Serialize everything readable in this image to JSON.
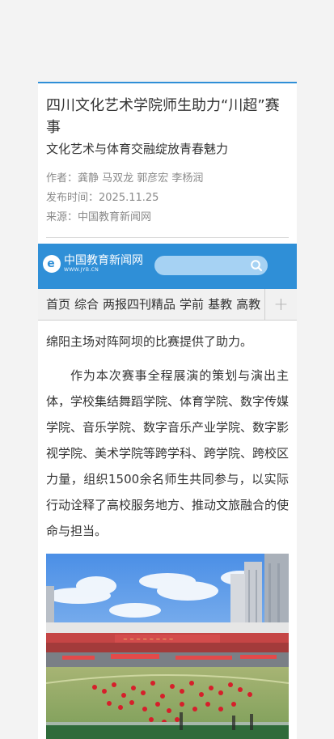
{
  "article": {
    "title": "四川文化艺术学院师生助力“川超”赛事",
    "subtitle": "文化艺术与体育交融绽放青春魅力",
    "author_label": "作者：龚静 马双龙 郭彦宏 李杨润",
    "date_label": "发布时间：2025.11.25",
    "source_label": "来源：中国教育新闻网",
    "paragraphs": [
      "绵阳主场对阵阿坝的比赛提供了助力。",
      "作为本次赛事全程展演的策划与演出主体，学校集结舞蹈学院、体育学院、数字传媒学院、音乐学院、数字音乐产业学院、数字影视学院、美术学院等跨学科、跨学院、跨校区力量，组织1500余名师生共同参与，以实际行动诠释了高校服务地方、推动文旅融合的使命与担当。"
    ]
  },
  "banner": {
    "logo_text": "中国教育新闻网",
    "logo_sub": "WWW.JYB.CN",
    "logo_letter": "e",
    "search_placeholder": ""
  },
  "nav": {
    "items": [
      "首页",
      "综合",
      "两报四刊精品",
      "学前",
      "基教",
      "高教"
    ],
    "plus": "+"
  },
  "colors": {
    "brand": "#2f8fd7",
    "search_bg": "#a6d2f3"
  },
  "icons": {
    "search": "search-icon",
    "plus": "plus-icon"
  }
}
